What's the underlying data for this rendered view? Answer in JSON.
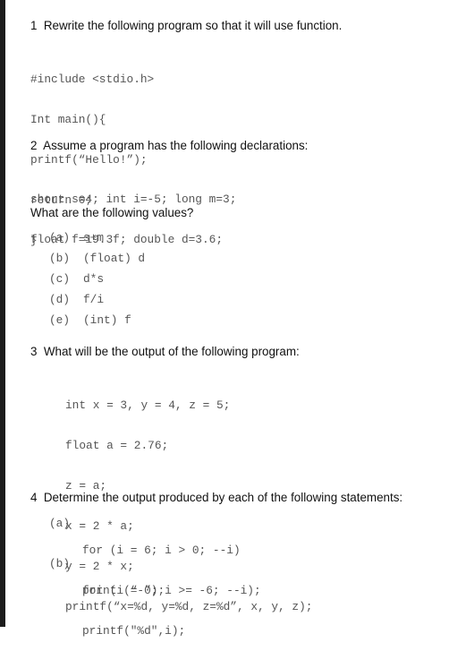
{
  "questions": {
    "q1": {
      "heading": "1  Rewrite the following program so that it will use function.",
      "code": [
        "#include <stdio.h>",
        "Int main(){",
        "printf(“Hello!”);",
        "return 0;",
        "}"
      ]
    },
    "q2": {
      "heading": "2  Assume a program has the following declarations:",
      "code": [
        "short s=4; int i=-5; long m=3;",
        "float f=19.3f; double d=3.6;"
      ],
      "prompt": "What are the following values?",
      "items": [
        {
          "label": "(a)",
          "expr": "s+m"
        },
        {
          "label": "(b)",
          "expr": "(float) d"
        },
        {
          "label": "(c)",
          "expr": "d*s"
        },
        {
          "label": "(d)",
          "expr": "f/i"
        },
        {
          "label": "(e)",
          "expr": "(int) f"
        }
      ]
    },
    "q3": {
      "heading": "3  What will be the output of the following program:",
      "code": [
        "int x = 3, y = 4, z = 5;",
        "float a = 2.76;",
        "z = a;",
        "x = 2 * a;",
        "y = 2 * x;",
        "printf(“x=%d, y=%d, z=%d”, x, y, z);"
      ]
    },
    "q4": {
      "heading": "4  Determine the output produced by each of the following statements:",
      "items": [
        {
          "label": "(a)",
          "code": [
            "for (i = 6; i > 0; --i)",
            "print (“-”);"
          ]
        },
        {
          "label": "(b)",
          "code": [
            "for (i = 0; i >= -6; --i);",
            "printf(\"%d\",i);"
          ]
        }
      ]
    }
  }
}
